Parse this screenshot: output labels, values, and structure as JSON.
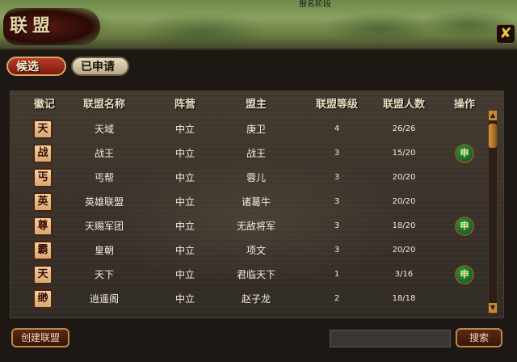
{
  "top_banner": "报名阶段",
  "window": {
    "title": "联盟",
    "close_icon": "close-icon"
  },
  "tabs": [
    {
      "label": "候选",
      "active": true
    },
    {
      "label": "已申请",
      "active": false
    }
  ],
  "table": {
    "headers": [
      "徽记",
      "联盟名称",
      "阵营",
      "盟主",
      "联盟等级",
      "联盟人数",
      "操作"
    ],
    "rows": [
      {
        "emblem": "天",
        "name": "天域",
        "camp": "中立",
        "leader": "庚卫",
        "level": "4",
        "members": "26/26",
        "apply": ""
      },
      {
        "emblem": "战",
        "name": "战王",
        "camp": "中立",
        "leader": "战王",
        "level": "3",
        "members": "15/20",
        "apply": "申"
      },
      {
        "emblem": "丐",
        "name": "丐帮",
        "camp": "中立",
        "leader": "蓉儿",
        "level": "3",
        "members": "20/20",
        "apply": ""
      },
      {
        "emblem": "英",
        "name": "英雄联盟",
        "camp": "中立",
        "leader": "诸葛牛",
        "level": "3",
        "members": "20/20",
        "apply": ""
      },
      {
        "emblem": "尊",
        "name": "天赐军团",
        "camp": "中立",
        "leader": "无敌将军",
        "level": "3",
        "members": "18/20",
        "apply": "申"
      },
      {
        "emblem": "霸",
        "name": "皇朝",
        "camp": "中立",
        "leader": "项文",
        "level": "3",
        "members": "20/20",
        "apply": ""
      },
      {
        "emblem": "天",
        "name": "天下",
        "camp": "中立",
        "leader": "君临天下",
        "level": "1",
        "members": "3/16",
        "apply": "申"
      },
      {
        "emblem": "缈",
        "name": "逍遥阁",
        "camp": "中立",
        "leader": "赵子龙",
        "level": "2",
        "members": "18/18",
        "apply": ""
      }
    ]
  },
  "footer": {
    "create_label": "创建联盟",
    "search_value": "",
    "search_label": "搜索"
  },
  "colors": {
    "tab_active": "#b83a28",
    "apply_button": "#1a8a30",
    "text_primary": "#f0ece0"
  }
}
